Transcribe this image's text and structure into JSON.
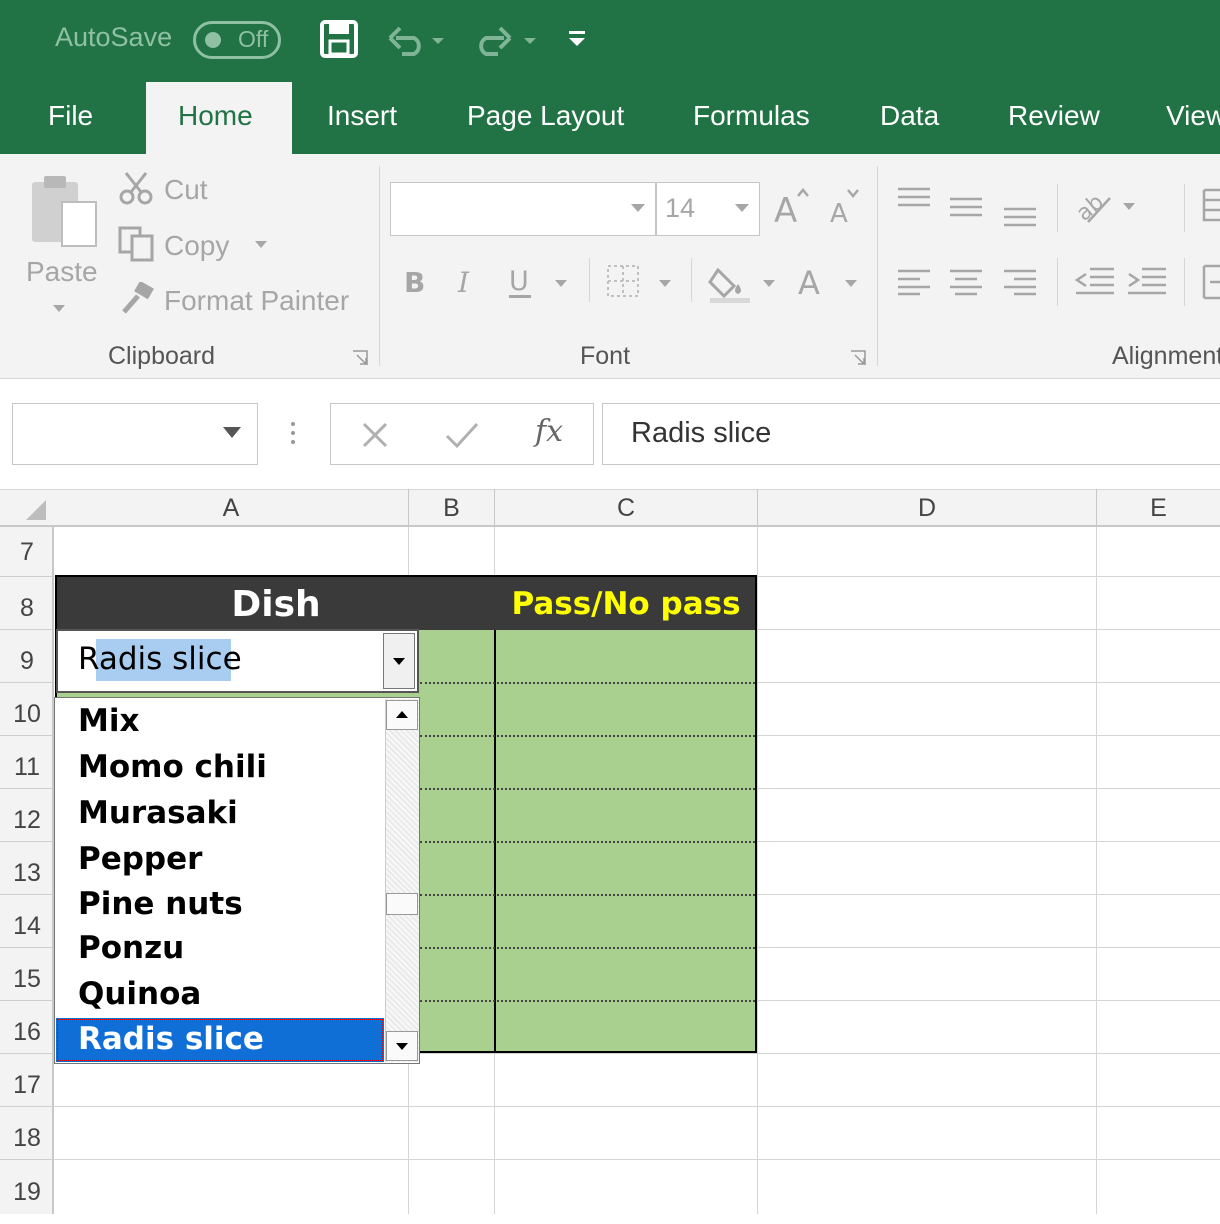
{
  "titlebar": {
    "autosave_label": "AutoSave",
    "autosave_state": "Off"
  },
  "tabs": [
    "File",
    "Home",
    "Insert",
    "Page Layout",
    "Formulas",
    "Data",
    "Review",
    "View"
  ],
  "clipboard": {
    "paste": "Paste",
    "cut": "Cut",
    "copy": "Copy",
    "format_painter": "Format Painter",
    "group": "Clipboard"
  },
  "font": {
    "name": "",
    "size": "14",
    "group": "Font"
  },
  "alignment": {
    "group": "Alignment"
  },
  "formula_bar": {
    "name_box": "",
    "fx": "fx",
    "value": "Radis slice"
  },
  "columns": [
    "A",
    "B",
    "C",
    "D",
    "E"
  ],
  "rows": [
    "7",
    "8",
    "9",
    "10",
    "11",
    "12",
    "13",
    "14",
    "15",
    "16",
    "17",
    "18",
    "19"
  ],
  "table": {
    "header_dish": "Dish",
    "header_pass": "Pass/No pass"
  },
  "cell_edit": {
    "value": "Radis slice"
  },
  "dropdown": {
    "items": [
      "Mix",
      "Momo chili",
      "Murasaki",
      "Pepper",
      "Pine nuts",
      "Ponzu",
      "Quinoa",
      "Radis slice"
    ],
    "selected": "Radis slice"
  },
  "colors": {
    "excel_green": "#217346",
    "header_dark": "#3a3a3a",
    "header_yellow": "#ffff00",
    "cell_green": "#a9d08e",
    "selection_blue": "#0f6fd6"
  }
}
